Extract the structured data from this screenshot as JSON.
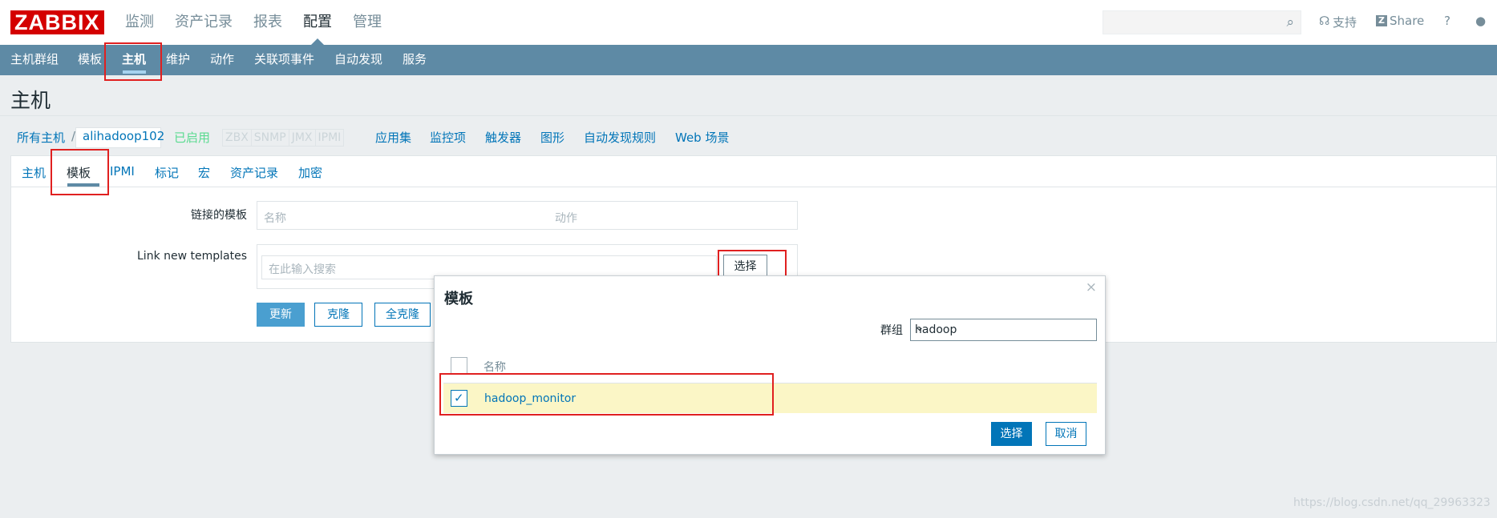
{
  "header": {
    "logo": "ZABBIX",
    "menu": [
      "监测",
      "资产记录",
      "报表",
      "配置",
      "管理"
    ],
    "active_menu": "配置",
    "search_placeholder": "",
    "support_label": "支持",
    "share_label": "Share",
    "help_label": "?"
  },
  "subnav": {
    "items": [
      "主机群组",
      "模板",
      "主机",
      "维护",
      "动作",
      "关联项事件",
      "自动发现",
      "服务"
    ],
    "active": "主机"
  },
  "page": {
    "title": "主机"
  },
  "breadcrumb": {
    "all_hosts": "所有主机",
    "separator": "/",
    "host": "alihadoop102",
    "status": "已启用",
    "availability": [
      "ZBX",
      "SNMP",
      "JMX",
      "IPMI"
    ],
    "links": [
      "应用集",
      "监控项",
      "触发器",
      "图形",
      "自动发现规则",
      "Web 场景"
    ]
  },
  "tabs": {
    "items": [
      "主机",
      "模板",
      "IPMI",
      "标记",
      "宏",
      "资产记录",
      "加密"
    ],
    "active": "模板"
  },
  "form": {
    "linked_templates_label": "链接的模板",
    "linked_col_name": "名称",
    "linked_col_action": "动作",
    "link_new_label": "Link new templates",
    "search_placeholder": "在此输入搜索",
    "select_button": "选择",
    "update_button": "更新",
    "clone_button": "克隆",
    "full_clone_button": "全克隆"
  },
  "dialog": {
    "title": "模板",
    "close": "×",
    "group_label": "群组",
    "group_value": "hadoop",
    "column_name": "名称",
    "rows": [
      {
        "name": "hadoop_monitor",
        "checked": true
      }
    ],
    "select_button": "选择",
    "cancel_button": "取消"
  },
  "watermark": "https://blog.csdn.net/qq_29963323",
  "colors": {
    "brand_red": "#d40000",
    "nav_bg": "#5e8aa5",
    "link_blue": "#0275b8",
    "enabled_green": "#59db8f",
    "highlight_row": "#fbf6c6",
    "annotation_red": "#e02020"
  }
}
